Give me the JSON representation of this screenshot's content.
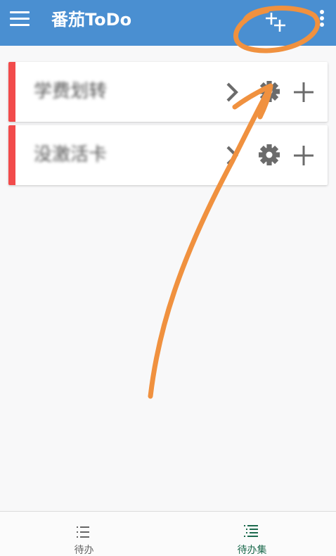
{
  "app": {
    "title": "番茄ToDo"
  },
  "toolbar": {
    "menu_icon": "hamburger-menu-icon",
    "add_list_icon": "add-list-icon",
    "more_icon": "more-vertical-icon"
  },
  "lists": [
    {
      "title": "学费划转",
      "accent_color": "#f24b4b"
    },
    {
      "title": "没激活卡",
      "accent_color": "#f24b4b"
    }
  ],
  "row_icons": [
    "chevron-right-icon",
    "gear-icon",
    "plus-icon"
  ],
  "bottom_nav": {
    "tabs": [
      {
        "label": "待办",
        "icon": "list-icon",
        "active": false
      },
      {
        "label": "待办集",
        "icon": "list-collection-icon",
        "active": true
      }
    ]
  },
  "colors": {
    "app_bar": "#4a8fd1",
    "accent": "#f24b4b",
    "active_tab": "#1c6a4d",
    "annotation": "#f0913f"
  }
}
